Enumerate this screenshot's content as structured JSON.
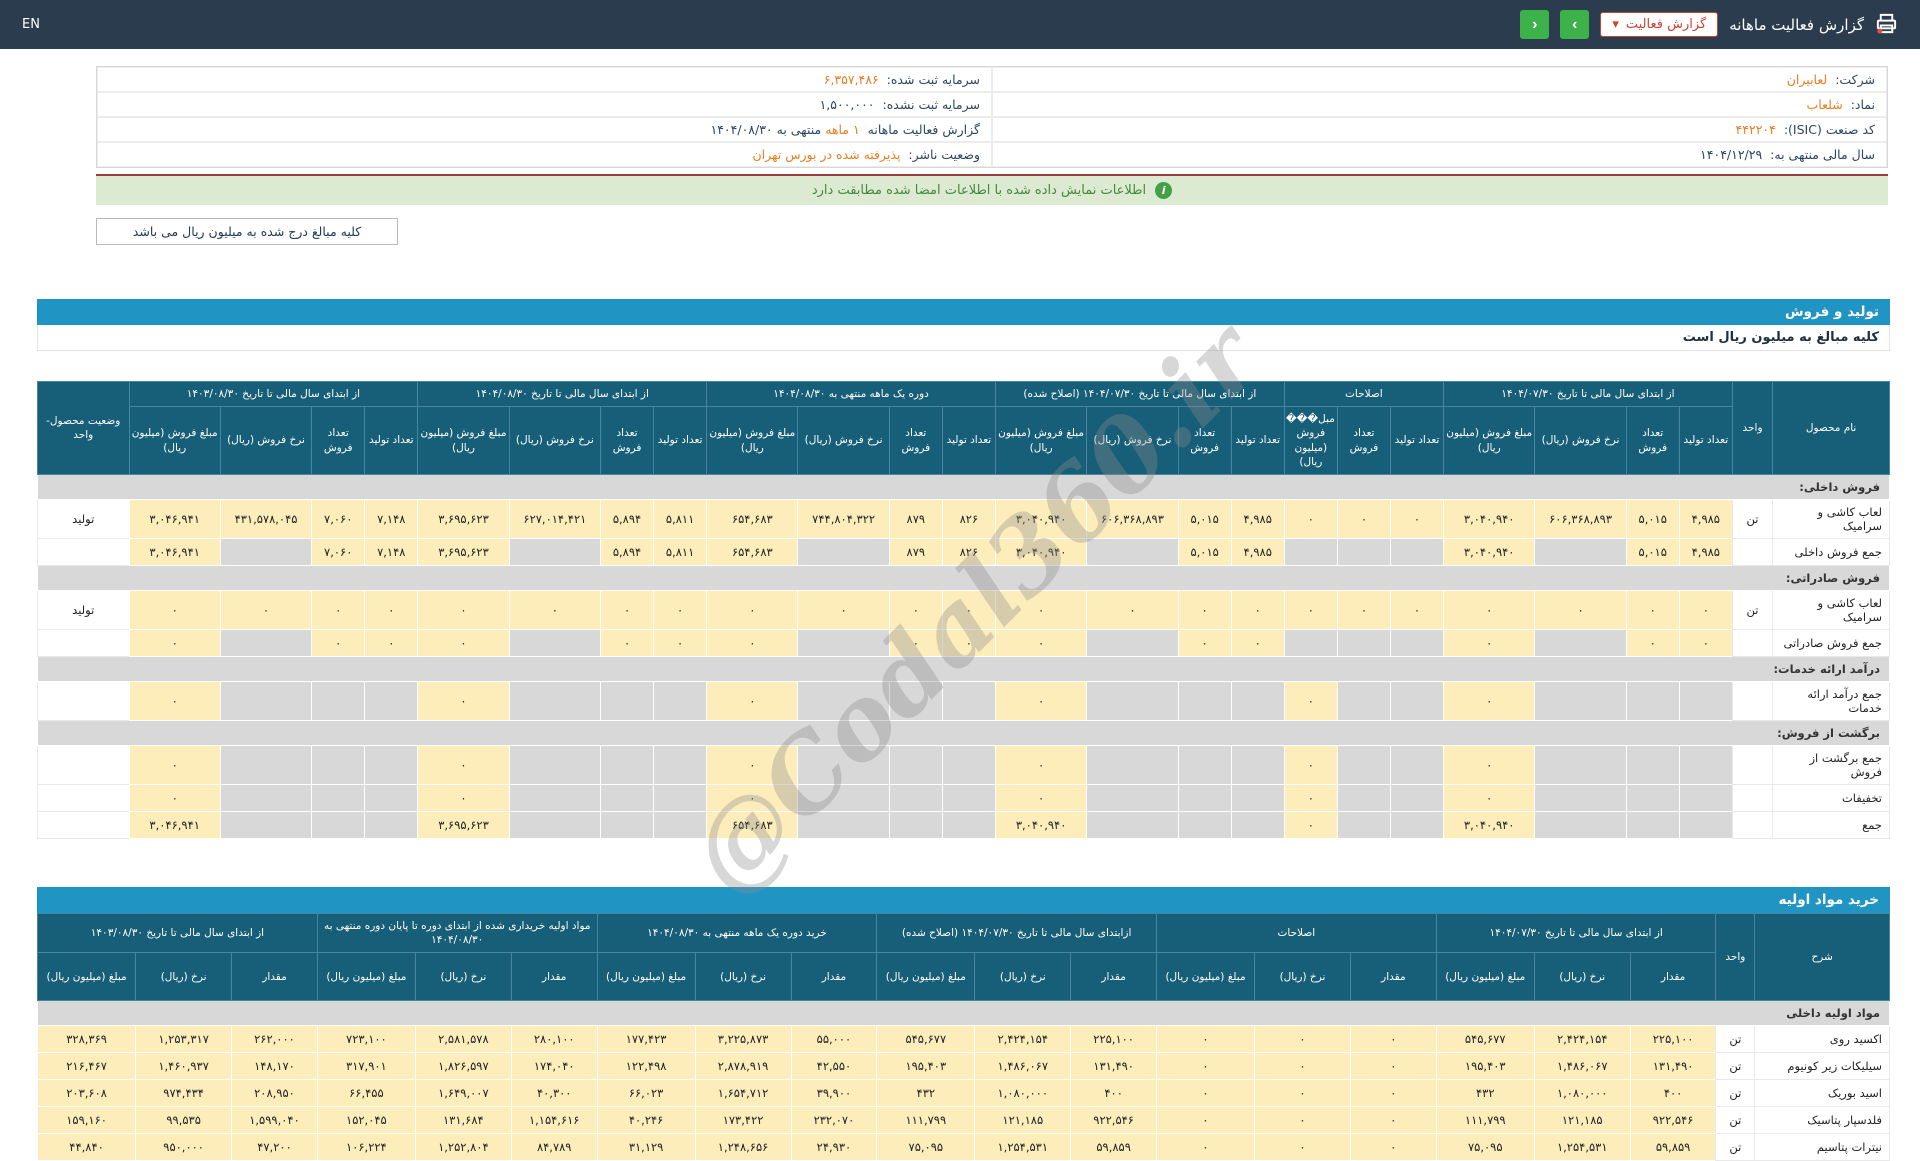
{
  "topbar": {
    "lang": "EN",
    "title": "گزارش فعالیت ماهانه",
    "report_button": "گزارش فعالیت",
    "caret": "▾",
    "next": "›",
    "prev": "‹"
  },
  "info": {
    "company_label": "شرکت:",
    "company": "لعابیران",
    "symbol_label": "نماد:",
    "symbol": "شلعاب",
    "isic_label": "کد صنعت (ISIC):",
    "isic": "۴۴۲۲۰۴",
    "fiscal_label": "سال مالی منتهی به:",
    "fiscal": "۱۴۰۴/۱۲/۲۹",
    "cap_reg_label": "سرمایه ثبت شده:",
    "cap_reg": "۶,۳۵۷,۴۸۶",
    "cap_unreg_label": "سرمایه ثبت نشده:",
    "cap_unreg": "۱,۵۰۰,۰۰۰",
    "period_prefix": "گزارش فعالیت ماهانه",
    "period_len": "۱ ماهه",
    "period_suffix": "منتهی به ۱۴۰۴/۰۸/۳۰",
    "status_label": "وضعیت ناشر:",
    "status": "پذیرفته شده در بورس تهران"
  },
  "banner": {
    "text": "اطلاعات نمایش داده شده با اطلاعات امضا شده مطابقت دارد"
  },
  "note_box": "کلیه مبالغ درج شده به میلیون ریال می باشد",
  "watermark": "@Codal360.ir",
  "production": {
    "bar": "تولید و فروش",
    "note": "کلیه مبالغ به میلیون ریال است",
    "name_header": "نام محصول",
    "unit_header": "واحد",
    "status_header": "وضعیت محصول-واحد",
    "groups": [
      {
        "title": "از ابتدای سال مالی تا تاریخ ۱۴۰۴/۰۷/۳۰",
        "cols": [
          "تعداد تولید",
          "تعداد فروش",
          "نرخ فروش (ریال)",
          "مبلغ فروش (میلیون ریال)"
        ]
      },
      {
        "title": "اصلاحات",
        "cols": [
          "تعداد تولید",
          "تعداد فروش",
          "مبل��� فروش (میلیون ریال)"
        ]
      },
      {
        "title": "از ابتدای سال مالی تا تاریخ ۱۴۰۴/۰۷/۳۰ (اصلاح شده)",
        "cols": [
          "تعداد تولید",
          "تعداد فروش",
          "نرخ فروش (ریال)",
          "مبلغ فروش (میلیون ریال)"
        ]
      },
      {
        "title": "دوره یک ماهه منتهی به ۱۴۰۴/۰۸/۳۰",
        "cols": [
          "تعداد تولید",
          "تعداد فروش",
          "نرخ فروش (ریال)",
          "مبلغ فروش (میلیون ریال)"
        ]
      },
      {
        "title": "از ابتدای سال مالی تا تاریخ ۱۴۰۴/۰۸/۳۰",
        "cols": [
          "تعداد تولید",
          "تعداد فروش",
          "نرخ فروش (ریال)",
          "مبلغ فروش (میلیون ریال)"
        ]
      },
      {
        "title": "از ابتدای سال مالی تا تاریخ ۱۴۰۳/۰۸/۳۰",
        "cols": [
          "تعداد تولید",
          "تعداد فروش",
          "نرخ فروش (ریال)",
          "مبلغ فروش (میلیون ریال)"
        ]
      }
    ],
    "rows": [
      {
        "type": "section",
        "name": "فروش داخلی:"
      },
      {
        "type": "product",
        "name": "لعاب کاشی و سرامیک",
        "unit": "تن",
        "status": "تولید",
        "cells": [
          "۴,۹۸۵",
          "۵,۰۱۵",
          "۶۰۶,۳۶۸,۸۹۳",
          "۳,۰۴۰,۹۴۰",
          "۰",
          "۰",
          "۰",
          "۴,۹۸۵",
          "۵,۰۱۵",
          "۶۰۶,۳۶۸,۸۹۳",
          "۳,۰۴۰,۹۴۰",
          "۸۲۶",
          "۸۷۹",
          "۷۴۴,۸۰۴,۳۲۲",
          "۶۵۴,۶۸۳",
          "۵,۸۱۱",
          "۵,۸۹۴",
          "۶۲۷,۰۱۴,۴۲۱",
          "۳,۶۹۵,۶۲۳",
          "۷,۱۴۸",
          "۷,۰۶۰",
          "۴۳۱,۵۷۸,۰۴۵",
          "۳,۰۴۶,۹۴۱"
        ]
      },
      {
        "type": "total",
        "name": "جمع فروش داخلی",
        "unit": "",
        "status": "",
        "cells": [
          "۴,۹۸۵",
          "۵,۰۱۵",
          "",
          "۳,۰۴۰,۹۴۰",
          "",
          "",
          "",
          "۴,۹۸۵",
          "۵,۰۱۵",
          "",
          "۳,۰۴۰,۹۴۰",
          "۸۲۶",
          "۸۷۹",
          "",
          "۶۵۴,۶۸۳",
          "۵,۸۱۱",
          "۵,۸۹۴",
          "",
          "۳,۶۹۵,۶۲۳",
          "۷,۱۴۸",
          "۷,۰۶۰",
          "",
          "۳,۰۴۶,۹۴۱"
        ]
      },
      {
        "type": "section",
        "name": "فروش صادراتی:"
      },
      {
        "type": "product",
        "name": "لعاب کاشی و سرامیک",
        "unit": "تن",
        "status": "تولید",
        "cells": [
          "۰",
          "۰",
          "۰",
          "۰",
          "۰",
          "۰",
          "۰",
          "۰",
          "۰",
          "۰",
          "۰",
          "۰",
          "۰",
          "۰",
          "۰",
          "۰",
          "۰",
          "۰",
          "۰",
          "۰",
          "۰",
          "۰",
          "۰"
        ]
      },
      {
        "type": "total",
        "name": "جمع فروش صادراتی",
        "unit": "",
        "status": "",
        "cells": [
          "۰",
          "۰",
          "",
          "۰",
          "",
          "",
          "",
          "۰",
          "۰",
          "",
          "۰",
          "۰",
          "۰",
          "",
          "۰",
          "۰",
          "۰",
          "",
          "۰",
          "۰",
          "۰",
          "",
          "۰"
        ]
      },
      {
        "type": "section",
        "name": "درآمد ارائه خدمات:"
      },
      {
        "type": "total",
        "name": "جمع درآمد ارائه خدمات",
        "unit": "",
        "status": "",
        "cells": [
          "",
          "",
          "",
          "۰",
          "",
          "",
          "۰",
          "",
          "",
          "",
          "۰",
          "",
          "",
          "",
          "۰",
          "",
          "",
          "",
          "۰",
          "",
          "",
          "",
          "۰"
        ]
      },
      {
        "type": "section",
        "name": "برگشت از فروش:"
      },
      {
        "type": "total",
        "name": "جمع برگشت از فروش",
        "unit": "",
        "status": "",
        "cells": [
          "",
          "",
          "",
          "۰",
          "",
          "",
          "۰",
          "",
          "",
          "",
          "۰",
          "",
          "",
          "",
          "۰",
          "",
          "",
          "",
          "۰",
          "",
          "",
          "",
          "۰"
        ]
      },
      {
        "type": "total",
        "name": "تخفیفات",
        "unit": "",
        "status": "",
        "cells": [
          "",
          "",
          "",
          "۰",
          "",
          "",
          "۰",
          "",
          "",
          "",
          "۰",
          "",
          "",
          "",
          "۰",
          "",
          "",
          "",
          "۰",
          "",
          "",
          "",
          "۰"
        ]
      },
      {
        "type": "total",
        "name": "جمع",
        "unit": "",
        "status": "",
        "cells": [
          "",
          "",
          "",
          "۳,۰۴۰,۹۴۰",
          "",
          "",
          "۰",
          "",
          "",
          "",
          "۳,۰۴۰,۹۴۰",
          "",
          "",
          "",
          "۶۵۴,۶۸۳",
          "",
          "",
          "",
          "۳,۶۹۵,۶۲۳",
          "",
          "",
          "",
          "۳,۰۴۶,۹۴۱"
        ]
      }
    ]
  },
  "materials": {
    "bar": "خرید مواد اولیه",
    "name_header": "شرح",
    "unit_header": "واحد",
    "groups": [
      {
        "title": "از ابتدای سال مالی تا تاریخ ۱۴۰۴/۰۷/۳۰",
        "cols": [
          "مقدار",
          "نرخ (ریال)",
          "مبلغ (میلیون ریال)"
        ]
      },
      {
        "title": "اصلاحات",
        "cols": [
          "مقدار",
          "نرخ (ریال)",
          "مبلغ (میلیون ریال)"
        ]
      },
      {
        "title": "ازابتدای سال مالی تا تاریخ ۱۴۰۴/۰۷/۳۰ (اصلاح شده)",
        "cols": [
          "مقدار",
          "نرخ (ریال)",
          "مبلغ (میلیون ریال)"
        ]
      },
      {
        "title": "خرید دوره یک ماهه منتهی به ۱۴۰۴/۰۸/۳۰",
        "cols": [
          "مقدار",
          "نرخ (ریال)",
          "مبلغ (میلیون ریال)"
        ]
      },
      {
        "title": "مواد اولیه خریداری شده از ابتدای دوره تا پایان دوره منتهی به ۱۴۰۴/۰۸/۳۰",
        "cols": [
          "مقدار",
          "نرخ (ریال)",
          "مبلغ (میلیون ریال)"
        ]
      },
      {
        "title": "از ابتدای سال مالی تا تاریخ ۱۴۰۳/۰۸/۳۰",
        "cols": [
          "مقدار",
          "نرخ (ریال)",
          "مبلغ (میلیون ریال)"
        ]
      }
    ],
    "rows": [
      {
        "type": "section",
        "name": "مواد اولیه داخلی"
      },
      {
        "type": "product",
        "name": "اکسید روی",
        "unit": "تن",
        "cells": [
          "۲۲۵,۱۰۰",
          "۲,۴۲۴,۱۵۴",
          "۵۴۵,۶۷۷",
          "۰",
          "۰",
          "۰",
          "۲۲۵,۱۰۰",
          "۲,۴۲۴,۱۵۴",
          "۵۴۵,۶۷۷",
          "۵۵,۰۰۰",
          "۳,۲۲۵,۸۷۳",
          "۱۷۷,۴۲۳",
          "۲۸۰,۱۰۰",
          "۲,۵۸۱,۵۷۸",
          "۷۲۳,۱۰۰",
          "۲۶۲,۰۰۰",
          "۱,۲۵۳,۳۱۷",
          "۳۲۸,۳۶۹"
        ]
      },
      {
        "type": "product",
        "name": "سیلیکات زیر کونیوم",
        "unit": "تن",
        "cells": [
          "۱۳۱,۴۹۰",
          "۱,۴۸۶,۰۶۷",
          "۱۹۵,۴۰۳",
          "۰",
          "۰",
          "۰",
          "۱۳۱,۴۹۰",
          "۱,۴۸۶,۰۶۷",
          "۱۹۵,۴۰۳",
          "۴۲,۵۵۰",
          "۲,۸۷۸,۹۱۹",
          "۱۲۲,۴۹۸",
          "۱۷۴,۰۴۰",
          "۱,۸۲۶,۵۹۷",
          "۳۱۷,۹۰۱",
          "۱۴۸,۱۷۰",
          "۱,۴۶۰,۹۳۷",
          "۲۱۶,۴۶۷"
        ]
      },
      {
        "type": "product",
        "name": "اسید بوریک",
        "unit": "تن",
        "cells": [
          "۴۰۰",
          "۱,۰۸۰,۰۰۰",
          "۴۳۲",
          "۰",
          "۰",
          "۰",
          "۴۰۰",
          "۱,۰۸۰,۰۰۰",
          "۴۳۲",
          "۳۹,۹۰۰",
          "۱,۶۵۴,۷۱۲",
          "۶۶,۰۲۳",
          "۴۰,۳۰۰",
          "۱,۶۴۹,۰۰۷",
          "۶۶,۴۵۵",
          "۲۰۸,۹۵۰",
          "۹۷۴,۴۳۴",
          "۲۰۳,۶۰۸"
        ]
      },
      {
        "type": "product",
        "name": "فلدسپار پتاسیک",
        "unit": "تن",
        "cells": [
          "۹۲۲,۵۴۶",
          "۱۲۱,۱۸۵",
          "۱۱۱,۷۹۹",
          "۰",
          "۰",
          "۰",
          "۹۲۲,۵۴۶",
          "۱۲۱,۱۸۵",
          "۱۱۱,۷۹۹",
          "۲۳۲,۰۷۰",
          "۱۷۳,۴۲۲",
          "۴۰,۲۴۶",
          "۱,۱۵۴,۶۱۶",
          "۱۳۱,۶۸۴",
          "۱۵۲,۰۴۵",
          "۱,۵۹۹,۰۴۰",
          "۹۹,۵۳۵",
          "۱۵۹,۱۶۰"
        ]
      },
      {
        "type": "product",
        "name": "نیترات پتاسیم",
        "unit": "تن",
        "cells": [
          "۵۹,۸۵۹",
          "۱,۲۵۴,۵۳۱",
          "۷۵,۰۹۵",
          "۰",
          "۰",
          "۰",
          "۵۹,۸۵۹",
          "۱,۲۵۴,۵۳۱",
          "۷۵,۰۹۵",
          "۲۴,۹۳۰",
          "۱,۲۴۸,۶۵۶",
          "۳۱,۱۲۹",
          "۸۴,۷۸۹",
          "۱,۲۵۲,۸۰۴",
          "۱۰۶,۲۲۴",
          "۴۷,۲۰۰",
          "۹۵۰,۰۰۰",
          "۴۴,۸۴۰"
        ]
      }
    ]
  }
}
